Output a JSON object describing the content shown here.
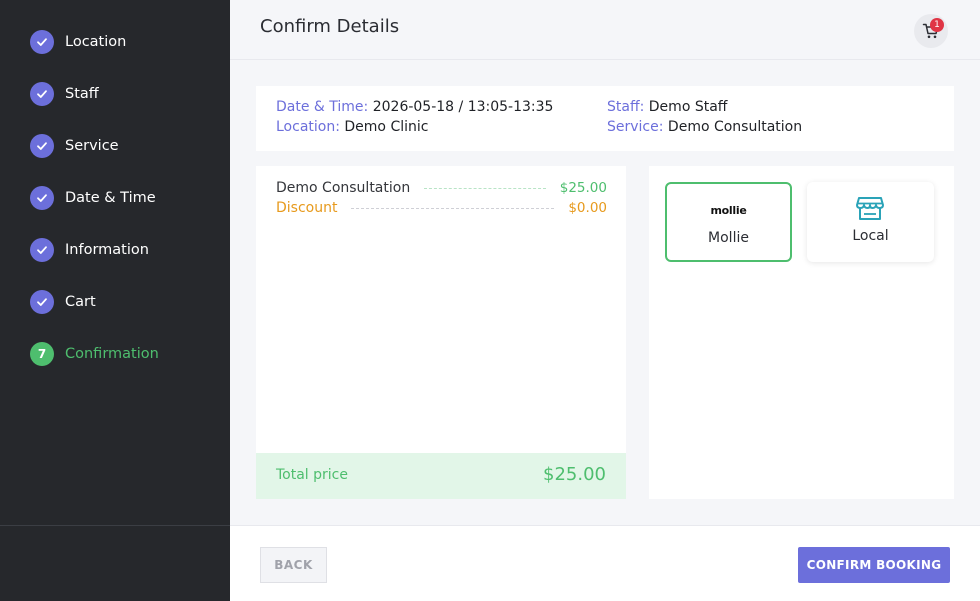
{
  "sidebar": {
    "steps": [
      {
        "label": "Location",
        "state": "done"
      },
      {
        "label": "Staff",
        "state": "done"
      },
      {
        "label": "Service",
        "state": "done"
      },
      {
        "label": "Date & Time",
        "state": "done"
      },
      {
        "label": "Information",
        "state": "done"
      },
      {
        "label": "Cart",
        "state": "done"
      },
      {
        "label": "Confirmation",
        "state": "active",
        "number": "7"
      }
    ]
  },
  "header": {
    "title": "Confirm Details",
    "cart_icon": "cart-icon",
    "cart_count": "1"
  },
  "details": {
    "datetime_key": "Date & Time:",
    "datetime_value": "2026-05-18 / 13:05-13:35",
    "location_key": "Location:",
    "location_value": "Demo Clinic",
    "staff_key": "Staff:",
    "staff_value": "Demo Staff",
    "service_key": "Service:",
    "service_value": "Demo Consultation"
  },
  "order": {
    "items": [
      {
        "name": "Demo Consultation",
        "price": "$25.00"
      },
      {
        "name": "Discount",
        "price": "$0.00"
      }
    ],
    "total_label": "Total price",
    "total_value": "$25.00"
  },
  "payment": {
    "methods": [
      {
        "logo_text": "mollie",
        "label": "Mollie",
        "selected": true
      },
      {
        "icon": "store-icon",
        "label": "Local",
        "selected": false
      }
    ]
  },
  "footer": {
    "back_label": "BACK",
    "confirm_label": "CONFIRM BOOKING"
  },
  "colors": {
    "accent": "#6c6fdb",
    "success": "#4ebe6e",
    "discount": "#e79a1d",
    "sidebar_bg": "#26282c",
    "badge": "#e03545"
  }
}
